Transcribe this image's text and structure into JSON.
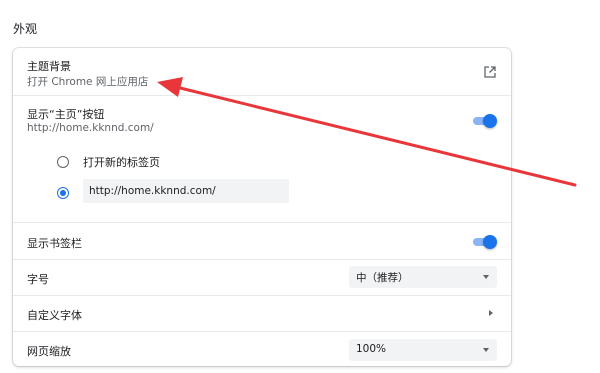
{
  "section": {
    "title": "外观"
  },
  "theme": {
    "title": "主题背景",
    "subtitle": "打开 Chrome 网上应用店",
    "icon": "open-in-new-icon"
  },
  "home_button": {
    "title": "显示“主页”按钮",
    "url": "http://home.kknnd.com/",
    "enabled": true,
    "options": [
      {
        "label": "打开新的标签页",
        "selected": false
      },
      {
        "value": "http://home.kknnd.com/",
        "selected": true
      }
    ]
  },
  "bookmarks_bar": {
    "label": "显示书签栏",
    "enabled": true
  },
  "font_size": {
    "label": "字号",
    "value": "中（推荐）"
  },
  "custom_fonts": {
    "label": "自定义字体"
  },
  "page_zoom": {
    "label": "网页缩放",
    "value": "100%"
  },
  "colors": {
    "accent": "#1a73e8",
    "toggle_track": "#8ab4f8",
    "annotation_arrow": "#e8363a"
  }
}
